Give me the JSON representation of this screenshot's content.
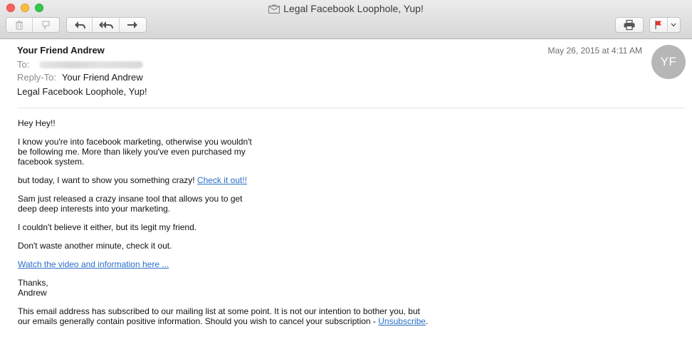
{
  "window": {
    "title": "Legal Facebook Loophole, Yup!"
  },
  "toolbar": {
    "buttons": [
      "trash-icon",
      "junk-icon",
      "reply-icon",
      "reply-all-icon",
      "forward-icon",
      "print-icon",
      "flag-icon"
    ]
  },
  "header": {
    "from": "Your Friend Andrew",
    "to_label": "To:",
    "reply_to_label": "Reply-To:",
    "reply_to": "Your Friend Andrew",
    "subject": "Legal Facebook Loophole, Yup!",
    "date": "May 26, 2015 at 4:11 AM",
    "avatar_initials": "YF"
  },
  "body": {
    "greeting": "Hey Hey!!",
    "para1": "I know you're into facebook marketing, otherwise you wouldn't be following me. More than likely you've even purchased my facebook system.",
    "para2_text": "but today, I want to show you something crazy! ",
    "para2_link": "Check it out!!",
    "para3": "Sam just released a crazy insane tool that allows you to get deep deep interests into your marketing.",
    "para4": "I couldn't believe it either, but its legit my friend.",
    "para5": "Don't waste another minute, check it out.",
    "video_link": "Watch the video and information here ... ",
    "signoff": "Thanks,",
    "signature": "Andrew",
    "footer_text": "This email address has subscribed to our mailing list at some point. It is not our intention to bother you, but our emails generally contain positive information. Should you wish to cancel your subscription - ",
    "unsubscribe": "Unsubscribe",
    "footer_end": "."
  },
  "colors": {
    "link": "#2a6ec8",
    "flag": "#e8322b",
    "avatar": "#b6b6b6"
  }
}
